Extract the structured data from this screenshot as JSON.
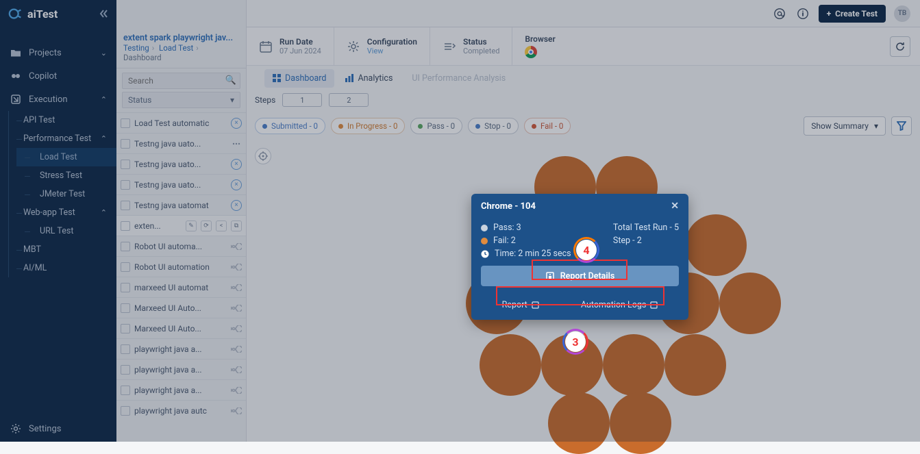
{
  "brand": "aiTest",
  "header": {
    "title": "Load Test",
    "create_label": "Create Test",
    "avatar_initials": "TB"
  },
  "sidebar": {
    "items": [
      {
        "label": "Projects"
      },
      {
        "label": "Copilot"
      },
      {
        "label": "Execution"
      }
    ],
    "exec_children": [
      {
        "label": "API Test"
      },
      {
        "label": "Performance Test"
      },
      {
        "label": "Web-app Test"
      },
      {
        "label": "MBT"
      },
      {
        "label": "AI/ML"
      }
    ],
    "perf_children": [
      {
        "label": "Load Test"
      },
      {
        "label": "Stress Test"
      },
      {
        "label": "JMeter Test"
      }
    ],
    "web_children": [
      {
        "label": "URL Test"
      }
    ],
    "settings_label": "Settings"
  },
  "crumb": {
    "project": "extent spark playwright jav...",
    "c1": "Testing",
    "c2": "Load Test",
    "dash": "Dashboard"
  },
  "search": {
    "placeholder": "Search",
    "status_label": "Status"
  },
  "tests": [
    {
      "label": "Load Test automatic",
      "icon": "blue-x"
    },
    {
      "label": "Testng java uato...",
      "icon": "dots"
    },
    {
      "label": "Testng java uato...",
      "icon": "blue-x"
    },
    {
      "label": "Testng java uato...",
      "icon": "blue-x"
    },
    {
      "label": "Testng java uatomat",
      "icon": "blue-x"
    },
    {
      "label": "exten...",
      "selected": true
    },
    {
      "label": "Robot UI automa...",
      "icon": "wave"
    },
    {
      "label": "Robot UI automation",
      "icon": "wave"
    },
    {
      "label": "marxeed UI automat",
      "icon": "wave"
    },
    {
      "label": "Marxeed UI Auto...",
      "icon": "wave"
    },
    {
      "label": "Marxeed UI Auto...",
      "icon": "wave"
    },
    {
      "label": "playwright java a...",
      "icon": "wave"
    },
    {
      "label": "playwright java a...",
      "icon": "wave"
    },
    {
      "label": "playwright java a...",
      "icon": "wave"
    },
    {
      "label": "playwright java autc",
      "icon": "wave"
    }
  ],
  "infobar": {
    "run_date_label": "Run Date",
    "run_date_value": "07 Jun 2024",
    "config_label": "Configuration",
    "config_value": "View",
    "status_label": "Status",
    "status_value": "Completed",
    "browser_label": "Browser"
  },
  "tabs": {
    "dashboard": "Dashboard",
    "analytics": "Analytics",
    "ui_perf": "UI Performance Analysis"
  },
  "steps": {
    "label": "Steps",
    "s1": "1",
    "s2": "2"
  },
  "pills": {
    "submitted": "Submitted - 0",
    "inprogress": "In Progress - 0",
    "pass": "Pass - 0",
    "stop": "Stop - 0",
    "fail": "Fail - 0"
  },
  "summary_label": "Show Summary",
  "popup": {
    "title": "Chrome - 104",
    "pass_label": "Pass: 3",
    "fail_label": "Fail: 2",
    "time_label": "Time: 2 min 25 secs",
    "total_label": "Total Test Run - 5",
    "step_label": "Step - 2",
    "report_details": "Report Details",
    "report": "Report",
    "automation_logs": "Automation Logs"
  },
  "annotations": {
    "three": "3",
    "four": "4"
  },
  "colors": {
    "fail_bubble": "#c96c2c",
    "popup_bg": "#1d5189"
  }
}
